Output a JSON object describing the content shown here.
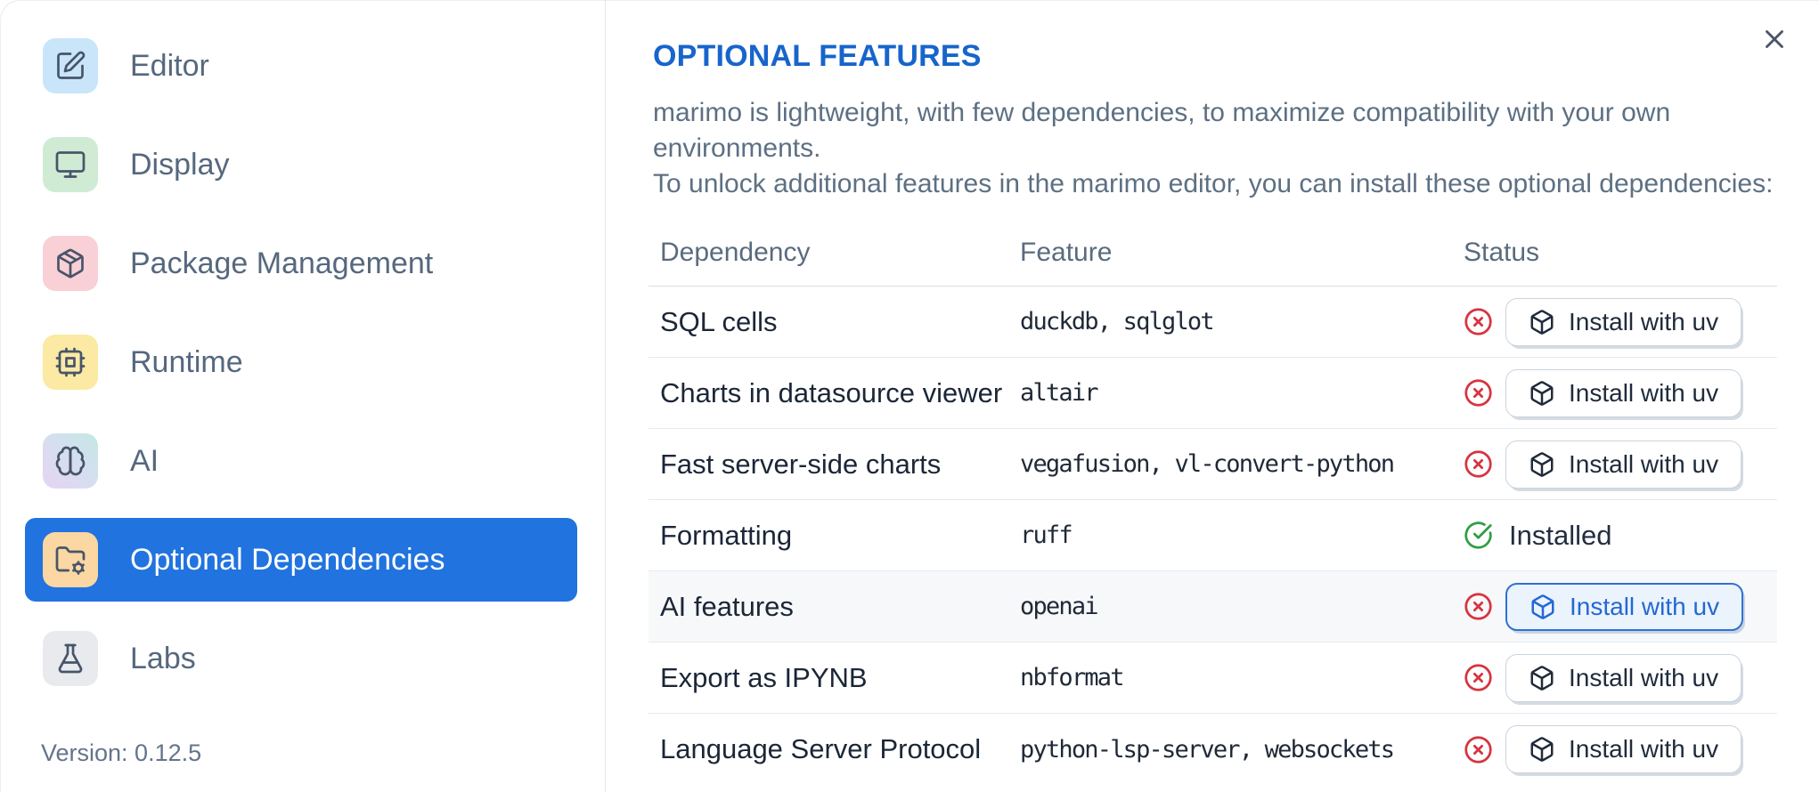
{
  "sidebar": {
    "items": [
      {
        "label": "Editor"
      },
      {
        "label": "Display"
      },
      {
        "label": "Package Management"
      },
      {
        "label": "Runtime"
      },
      {
        "label": "AI"
      },
      {
        "label": "Optional Dependencies",
        "selected": true
      },
      {
        "label": "Labs"
      }
    ],
    "version": "Version: 0.12.5"
  },
  "panel": {
    "title": "OPTIONAL FEATURES",
    "description_line1": "marimo is lightweight, with few dependencies, to maximize compatibility with your own environments.",
    "description_line2": "To unlock additional features in the marimo editor, you can install these optional dependencies:"
  },
  "table": {
    "headers": {
      "dependency": "Dependency",
      "feature": "Feature",
      "status": "Status"
    },
    "install_button_label": "Install with uv",
    "installed_label": "Installed",
    "rows": [
      {
        "dependency": "SQL cells",
        "feature": "duckdb, sqlglot",
        "status": "missing"
      },
      {
        "dependency": "Charts in datasource viewer",
        "feature": "altair",
        "status": "missing"
      },
      {
        "dependency": "Fast server-side charts",
        "feature": "vegafusion, vl-convert-python",
        "status": "missing"
      },
      {
        "dependency": "Formatting",
        "feature": "ruff",
        "status": "installed"
      },
      {
        "dependency": "AI features",
        "feature": "openai",
        "status": "missing",
        "focused": true
      },
      {
        "dependency": "Export as IPYNB",
        "feature": "nbformat",
        "status": "missing"
      },
      {
        "dependency": "Language Server Protocol",
        "feature": "python-lsp-server, websockets",
        "status": "missing"
      }
    ]
  },
  "colors": {
    "accent_blue": "#2173df",
    "title_blue": "#1765cc",
    "status_red": "#d63440",
    "status_green": "#2f9e44",
    "focused_button_blue": "#2468d3"
  }
}
